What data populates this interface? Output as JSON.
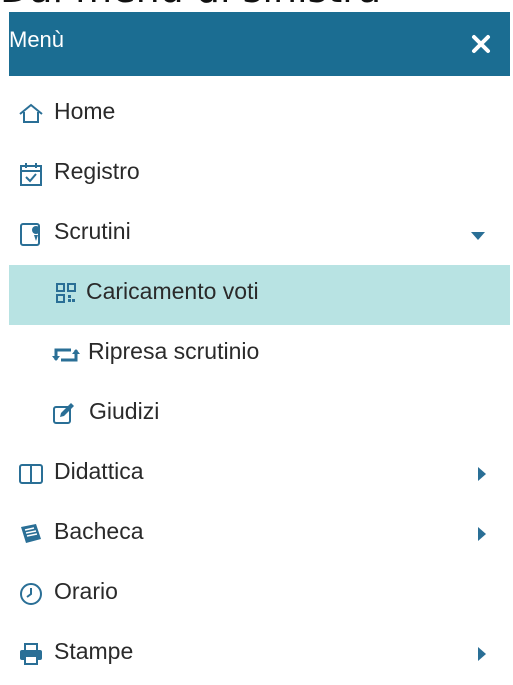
{
  "caption": "Dal menù di sinistra",
  "menu": {
    "title": "Menù",
    "close_icon": "close-icon",
    "items": [
      {
        "label": "Home",
        "icon": "home-icon"
      },
      {
        "label": "Registro",
        "icon": "calendar-icon"
      },
      {
        "label": "Scrutini",
        "icon": "scrutini-icon",
        "expanded": true
      },
      {
        "label": "Caricamento voti",
        "icon": "qrcode-icon",
        "active": true
      },
      {
        "label": "Ripresa scrutinio",
        "icon": "retweet-icon"
      },
      {
        "label": "Giudizi",
        "icon": "edit-icon"
      },
      {
        "label": "Didattica",
        "icon": "book-icon",
        "has_submenu": true
      },
      {
        "label": "Bacheca",
        "icon": "newspaper-icon",
        "has_submenu": true
      },
      {
        "label": "Orario",
        "icon": "clock-icon"
      },
      {
        "label": "Stampe",
        "icon": "printer-icon",
        "has_submenu": true
      }
    ]
  },
  "colors": {
    "header": "#1b6d92",
    "active": "#b8e3e3",
    "icon": "#2a6f96"
  }
}
